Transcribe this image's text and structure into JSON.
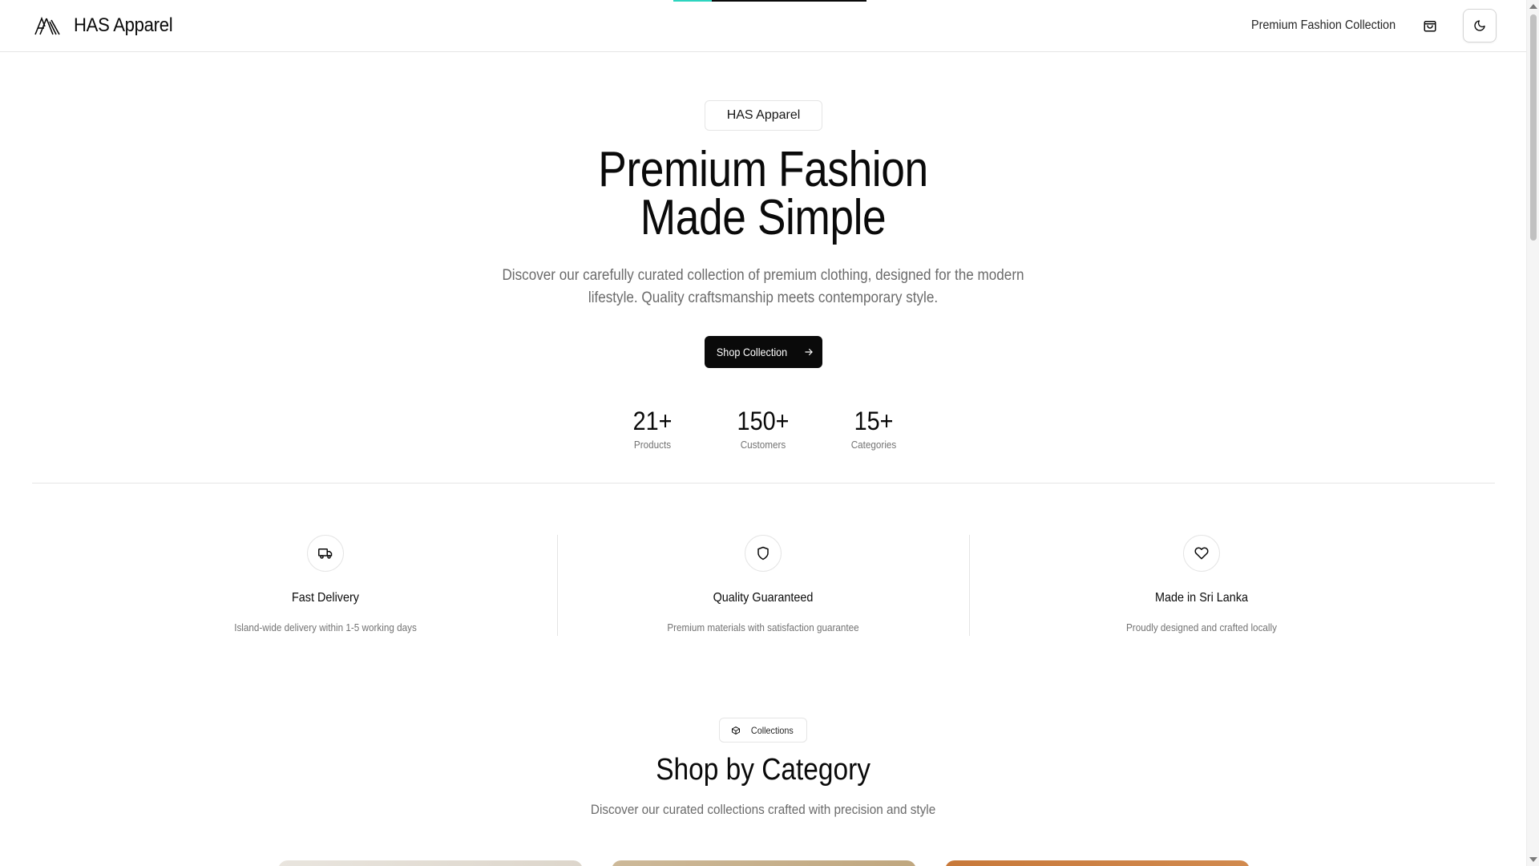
{
  "header": {
    "brand_name": "HAS Apparel",
    "tagline": "Premium Fashion Collection",
    "cart_icon": "shopping-bag-icon",
    "theme_icon": "moon-icon",
    "progress_fraction": 0.2
  },
  "hero": {
    "badge": "HAS Apparel",
    "title_line1": "Premium Fashion",
    "title_line2": "Made Simple",
    "subtitle_line1": "Discover our carefully curated collection of premium clothing, designed for the modern",
    "subtitle_line2": "lifestyle. Quality craftsmanship meets contemporary style.",
    "cta_label": "Shop Collection"
  },
  "stats": [
    {
      "value": "21+",
      "label": "Products"
    },
    {
      "value": "150+",
      "label": "Customers"
    },
    {
      "value": "15+",
      "label": "Categories"
    }
  ],
  "features": [
    {
      "icon": "truck-icon",
      "title": "Fast Delivery",
      "desc": "Island-wide delivery within 1-5 working days"
    },
    {
      "icon": "shield-icon",
      "title": "Quality Guaranteed",
      "desc": "Premium materials with satisfaction guarantee"
    },
    {
      "icon": "heart-icon",
      "title": "Made in Sri Lanka",
      "desc": "Proudly designed and crafted locally"
    }
  ],
  "collections": {
    "badge": "Collections",
    "title": "Shop by Category",
    "subtitle": "Discover our curated collections crafted with precision and style"
  },
  "colors": {
    "accent": "#0a0a0a",
    "progress": "#2dd4bf",
    "card_1": "#e7e2d9",
    "card_2": "#c9b493",
    "card_3": "#c97c3f"
  }
}
